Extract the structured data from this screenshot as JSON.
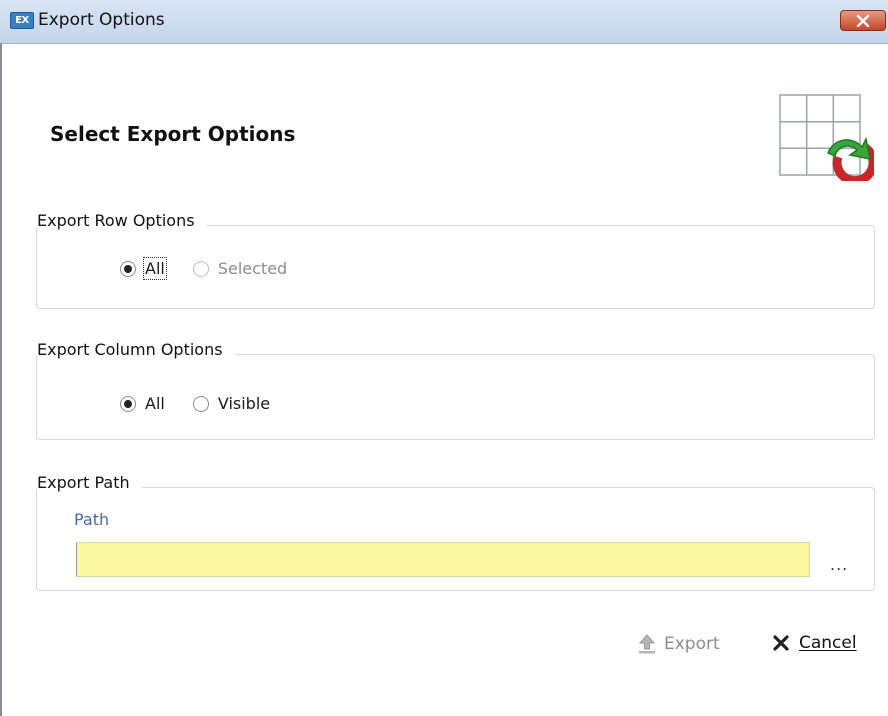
{
  "window": {
    "title": "Export Options",
    "app_icon_text": "EX"
  },
  "header": {
    "heading": "Select Export Options"
  },
  "row_options": {
    "legend": "Export Row Options",
    "options": [
      {
        "label": "All",
        "checked": true,
        "enabled": true
      },
      {
        "label": "Selected",
        "checked": false,
        "enabled": false
      }
    ]
  },
  "column_options": {
    "legend": "Export Column Options",
    "options": [
      {
        "label": "All",
        "checked": true,
        "enabled": true
      },
      {
        "label": "Visible",
        "checked": false,
        "enabled": true
      }
    ]
  },
  "export_path": {
    "legend": "Export Path",
    "field_label": "Path",
    "value": "",
    "browse_label": "..."
  },
  "footer": {
    "export_label": "Export",
    "cancel_label": "Cancel"
  },
  "colors": {
    "path_field_bg": "#fbf6a0",
    "titlebar": "#c5d5ea",
    "close_button": "#c6452a"
  }
}
